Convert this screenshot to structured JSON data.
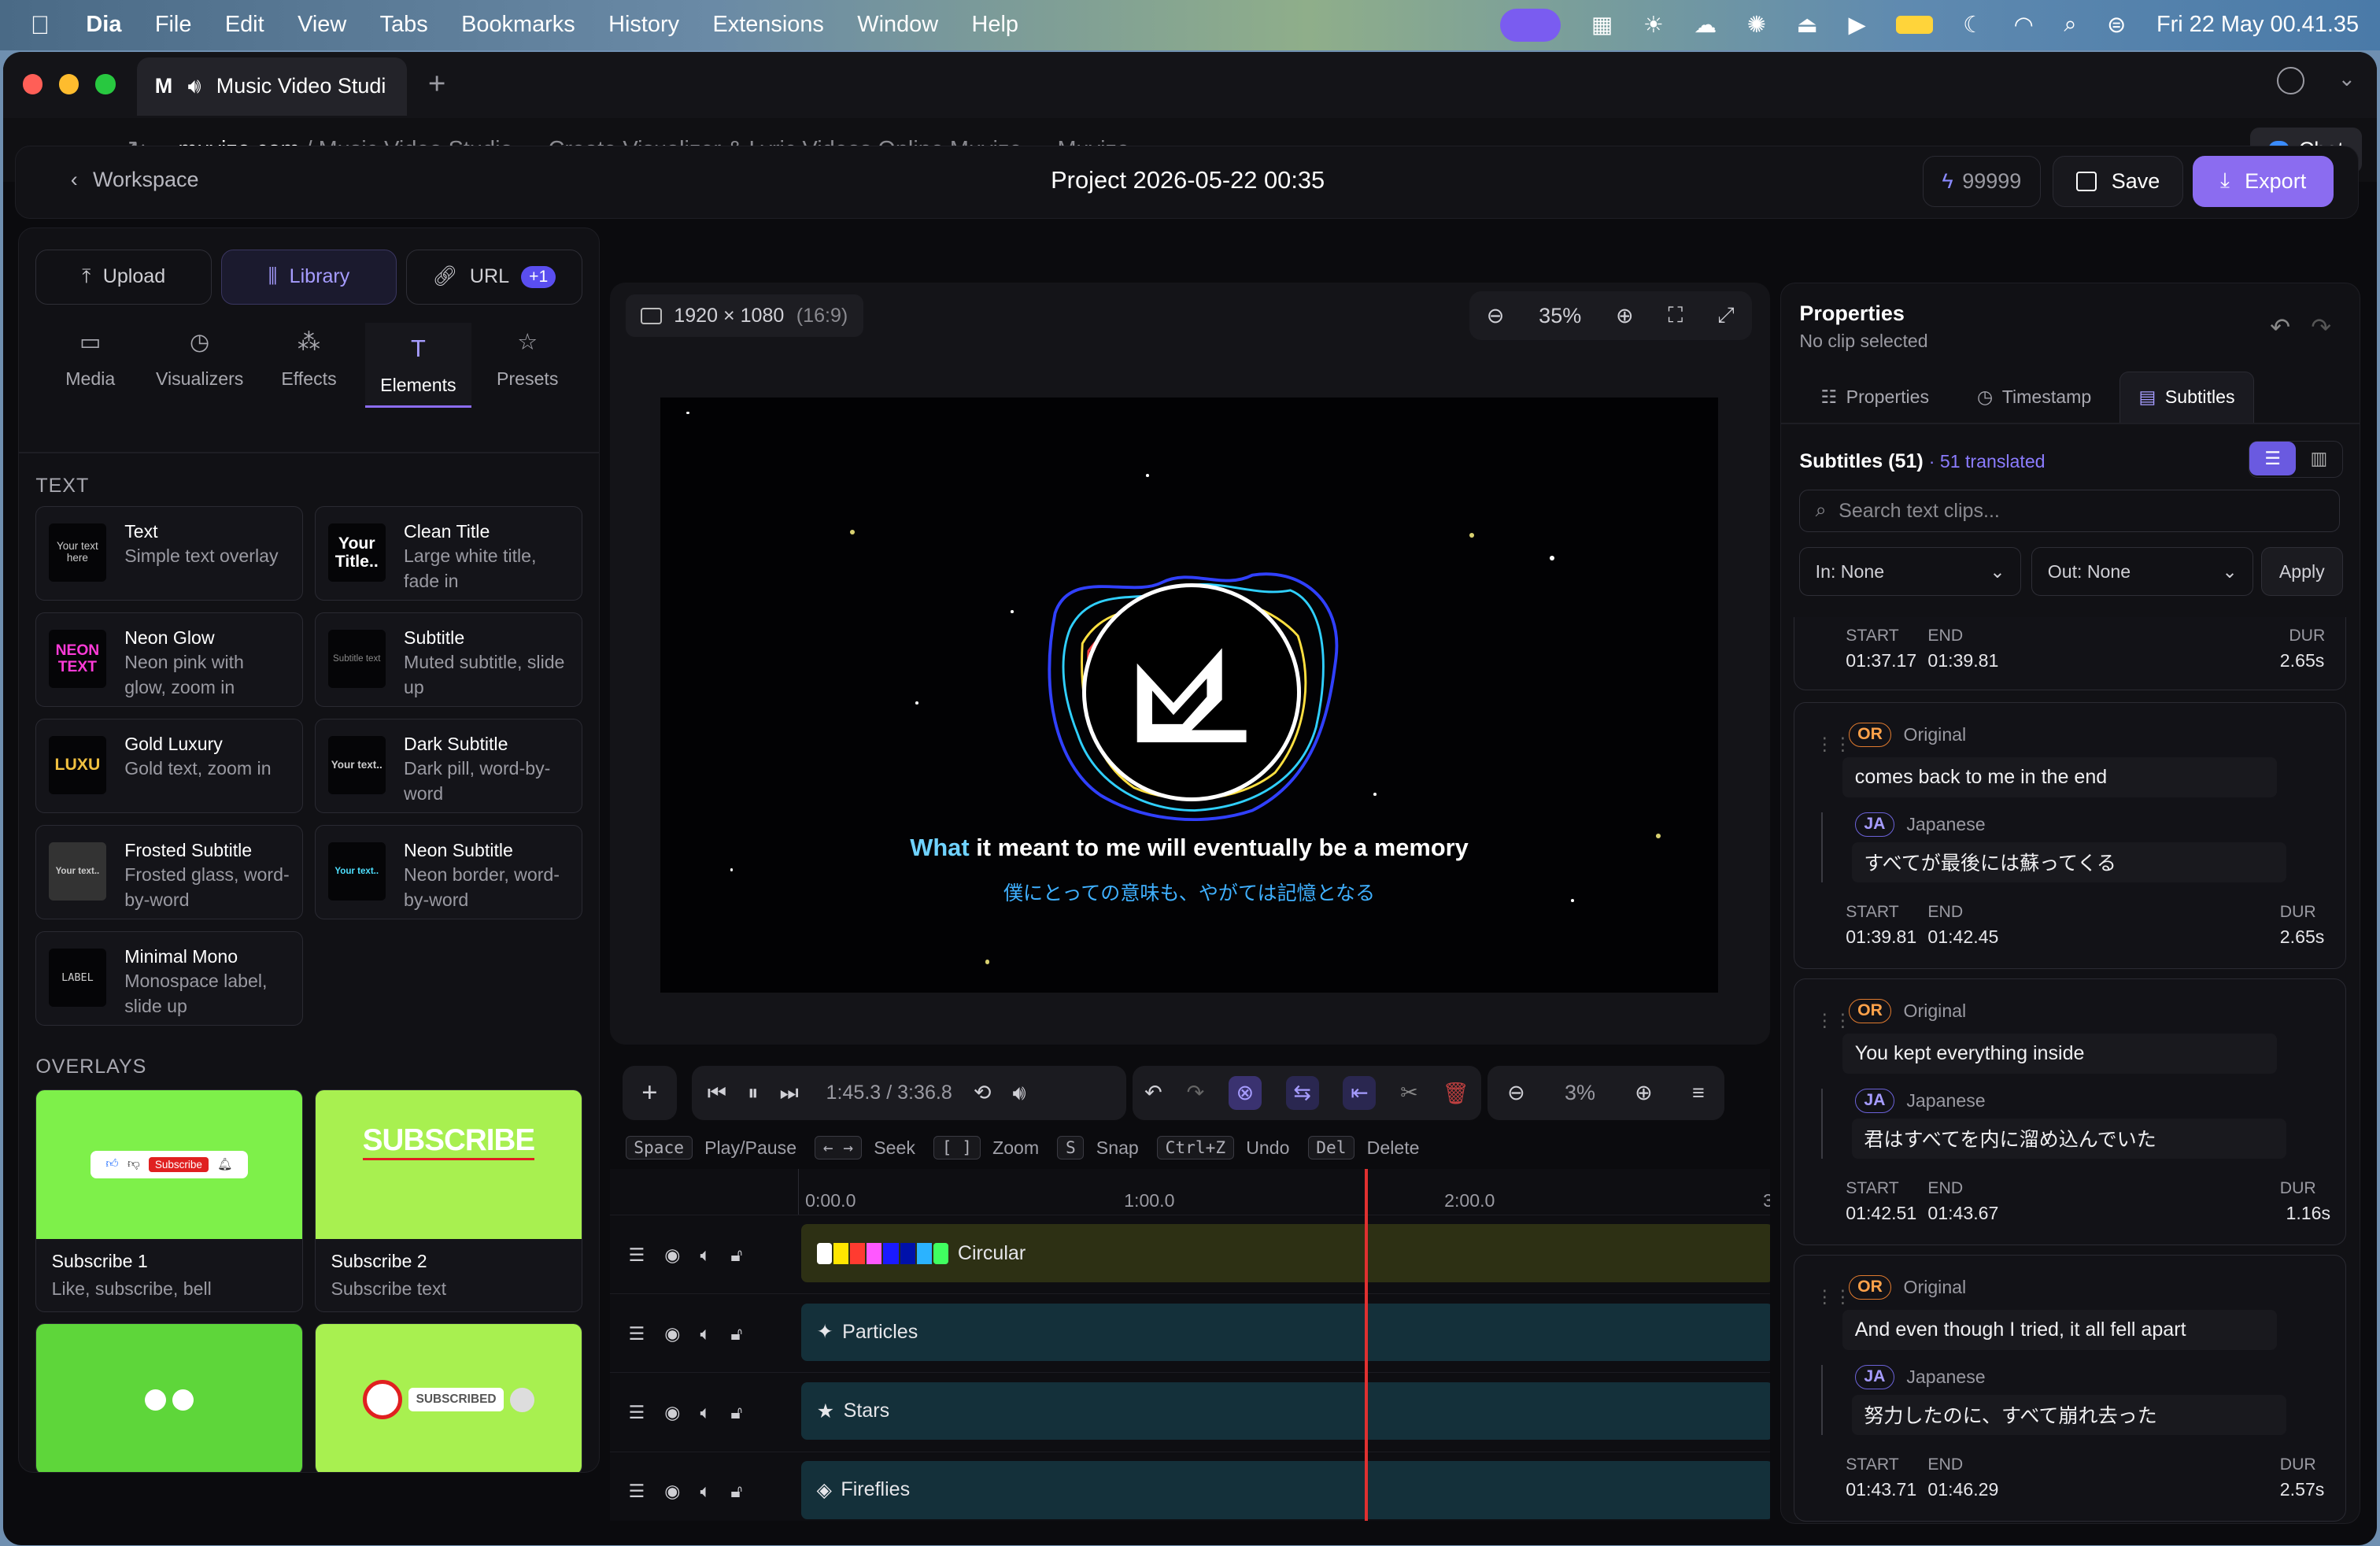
{
  "menubar": {
    "app": "Dia",
    "items": [
      "File",
      "Edit",
      "View",
      "Tabs",
      "Bookmarks",
      "History",
      "Extensions",
      "Window",
      "Help"
    ],
    "clock": "Fri 22 May  00.41.35"
  },
  "browser": {
    "tab_title": "Music Video Studi",
    "domain": "muvize.com",
    "path": " / Music Video Studio — Create Visualizer & Lyric Videos Online Muvize — Muvize",
    "chat_label": "Chat"
  },
  "header": {
    "back_label": "Workspace",
    "project_title": "Project 2026-05-22 00:35",
    "credits": "99999",
    "save_label": "Save",
    "export_label": "Export"
  },
  "left": {
    "upload": "Upload",
    "library": "Library",
    "url": "URL",
    "url_badge": "+1",
    "tabs": [
      "Media",
      "Visualizers",
      "Effects",
      "Elements",
      "Presets"
    ],
    "text_heading": "TEXT",
    "cards": [
      {
        "title": "Text",
        "desc": "Simple text overlay",
        "thumb": "Your text here"
      },
      {
        "title": "Clean Title",
        "desc": "Large white title, fade in",
        "thumb": "Your Title.."
      },
      {
        "title": "Neon Glow",
        "desc": "Neon pink with glow, zoom in",
        "thumb": "NEON TEXT"
      },
      {
        "title": "Subtitle",
        "desc": "Muted subtitle, slide up",
        "thumb": "Subtitle text"
      },
      {
        "title": "Gold Luxury",
        "desc": "Gold text, zoom in",
        "thumb": "LUXU"
      },
      {
        "title": "Dark Subtitle",
        "desc": "Dark pill, word-by-word",
        "thumb": "Your text.."
      },
      {
        "title": "Frosted Subtitle",
        "desc": "Frosted glass, word-by-word",
        "thumb": "Your text.."
      },
      {
        "title": "Neon Subtitle",
        "desc": "Neon border, word-by-word",
        "thumb": "Your text.."
      },
      {
        "title": "Minimal Mono",
        "desc": "Monospace label, slide up",
        "thumb": "LABEL"
      }
    ],
    "overlays_heading": "OVERLAYS",
    "overlays": [
      {
        "title": "Subscribe 1",
        "desc": "Like, subscribe, bell",
        "art": "Subscribe"
      },
      {
        "title": "Subscribe 2",
        "desc": "Subscribe text",
        "art": "SUBSCRIBE"
      },
      {
        "title": "",
        "desc": "",
        "art": ""
      },
      {
        "title": "",
        "desc": "",
        "art": "SUBSCRIBED"
      }
    ]
  },
  "preview": {
    "resolution": "1920 × 1080",
    "aspect": "(16:9)",
    "zoom": "35%",
    "lyric_highlight": "What",
    "lyric_rest": " it meant to me will eventually be a memory",
    "lyric_translation": "僕にとっての意味も、やがては記憶となる"
  },
  "controls": {
    "time": "1:45.3 / 3:36.8",
    "timeline_zoom": "3%"
  },
  "hints": [
    {
      "key": "Space",
      "label": "Play/Pause"
    },
    {
      "key": "← →",
      "label": "Seek"
    },
    {
      "key": "[ ]",
      "label": "Zoom"
    },
    {
      "key": "S",
      "label": "Snap"
    },
    {
      "key": "Ctrl+Z",
      "label": "Undo"
    },
    {
      "key": "Del",
      "label": "Delete"
    }
  ],
  "timeline": {
    "ruler": [
      "0:00.0",
      "1:00.0",
      "2:00.0",
      "3"
    ],
    "tracks": [
      {
        "name": "Circular",
        "color": "#2d3014"
      },
      {
        "name": "Particles",
        "color": "#14303a"
      },
      {
        "name": "Stars",
        "color": "#14303a"
      },
      {
        "name": "Fireflies",
        "color": "#14303a"
      }
    ],
    "playhead_time": "1:45.3",
    "swatches": [
      "#ffffff",
      "#ffe600",
      "#ff3b30",
      "#ff3ba0",
      "#ff58ff",
      "#1a1aff",
      "#0011aa",
      "#2bb3ff",
      "#40ff60"
    ]
  },
  "right": {
    "title": "Properties",
    "subtitle": "No clip selected",
    "tabs": [
      "Properties",
      "Timestamp",
      "Subtitles"
    ],
    "subs_title": "Subtitles (51)",
    "translated": "· 51 translated",
    "search_placeholder": "Search text clips...",
    "in_select": "In: None",
    "out_select": "Out: None",
    "apply": "Apply",
    "labels": {
      "start": "START",
      "end": "END",
      "dur": "DUR",
      "or": "OR",
      "original": "Original",
      "ja": "JA",
      "japanese": "Japanese"
    },
    "partial": {
      "start": "01:37.17",
      "end": "01:39.81",
      "dur": "2.65s"
    },
    "items": [
      {
        "text": "comes back to me in the end",
        "ja": "すべてが最後には蘇ってくる",
        "start": "01:39.81",
        "end": "01:42.45",
        "dur": "2.65s"
      },
      {
        "text": "You kept everything inside",
        "ja": "君はすべてを内に溜め込んでいた",
        "start": "01:42.51",
        "end": "01:43.67",
        "dur": "1.16s"
      },
      {
        "text": "And even though I tried, it all fell apart",
        "ja": "努力したのに、すべて崩れ去った",
        "start": "01:43.71",
        "end": "01:46.29",
        "dur": "2.57s"
      }
    ]
  }
}
